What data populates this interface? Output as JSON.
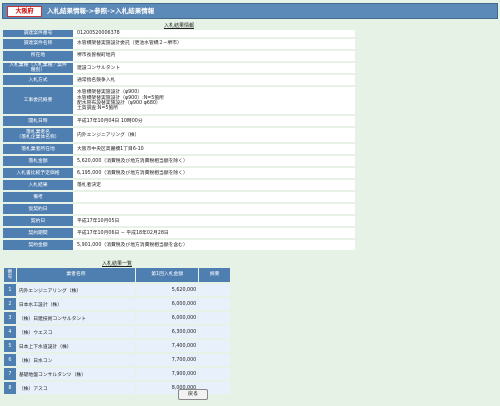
{
  "header": {
    "org": "大阪府",
    "title": "入札結果情報->参照->入札結果情報"
  },
  "info": {
    "caption": "入札結果情報",
    "rows": [
      {
        "k": "調達案件番号",
        "v": "01200520006378"
      },
      {
        "k": "調達案件名称",
        "v": "水管橋架替実施設計委託（更池水管橋２−堺市）"
      },
      {
        "k": "所在地",
        "v": "堺市長曽根町地内"
      },
      {
        "k": "入札業種（入札業種／案件種別）",
        "v": "建設コンサルタント"
      },
      {
        "k": "入札方式",
        "v": "通常指名競争入札"
      },
      {
        "k": "工事委託概要",
        "v": "水管橋架替実施設計（φ900）\n水管橋架替実施設計（φ900）:N=5箇所\n配水管布設替実施設計（φ900 φ680）\n土質調査:N=5箇所"
      },
      {
        "k": "開札日時",
        "v": "平成17年10月04日 10時00分"
      },
      {
        "k": "落札業者名\n（落札企業体名称）",
        "v": "内外エンジニアリング（株）"
      },
      {
        "k": "落札業者所在地",
        "v": "大阪市中央区高麗橋1丁目6-10"
      },
      {
        "k": "落札金額",
        "v": "5,620,000（消費税及び地方消費税相当額を除く）"
      },
      {
        "k": "入札書比較予定価格",
        "v": "6,195,000（消費税及び地方消費税相当額を除く）"
      },
      {
        "k": "入札結果",
        "v": "落札者決定"
      },
      {
        "k": "備考",
        "v": ""
      },
      {
        "k": "仮契約日",
        "v": ""
      },
      {
        "k": "契約日",
        "v": "平成17年10月05日"
      },
      {
        "k": "契約期間",
        "v": "平成17年10月06日 − 平成18年02月28日"
      },
      {
        "k": "契約金額",
        "v": "5,901,000（消費税及び地方消費税相当額を含む）"
      }
    ]
  },
  "list": {
    "caption": "入札結果一覧",
    "headers": {
      "no": "番号",
      "name": "業者名称",
      "amount": "第1回入札金額",
      "note": "摘要"
    },
    "rows": [
      {
        "no": "1",
        "name": "内外エンジニアリング（株）",
        "amount": "5,620,000",
        "note": ""
      },
      {
        "no": "2",
        "name": "日本水工設計（株）",
        "amount": "6,000,000",
        "note": ""
      },
      {
        "no": "3",
        "name": "（株）日建技術コンサルタント",
        "amount": "6,000,000",
        "note": ""
      },
      {
        "no": "4",
        "name": "（株）ウエスコ",
        "amount": "6,300,000",
        "note": ""
      },
      {
        "no": "5",
        "name": "日本上下水道設計（株）",
        "amount": "7,400,000",
        "note": ""
      },
      {
        "no": "6",
        "name": "（株）日水コン",
        "amount": "7,700,000",
        "note": ""
      },
      {
        "no": "7",
        "name": "基礎地盤コンサルタンツ（株）",
        "amount": "7,900,000",
        "note": ""
      },
      {
        "no": "8",
        "name": "（株）アスコ",
        "amount": "8,000,000",
        "note": ""
      }
    ]
  },
  "back_label": "戻る"
}
